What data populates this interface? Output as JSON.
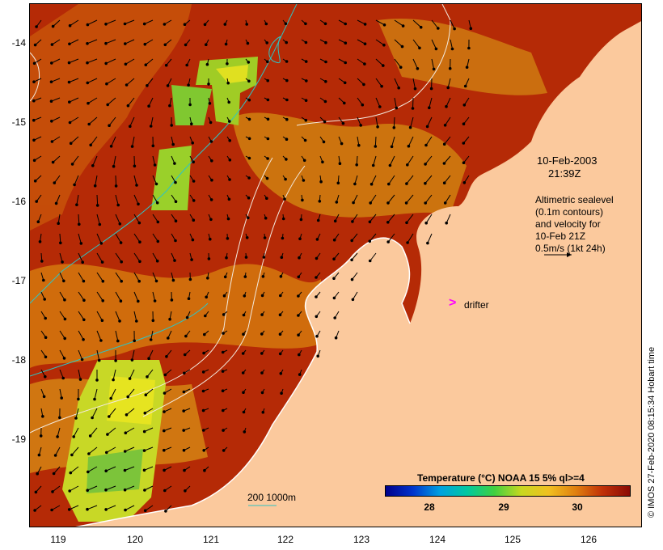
{
  "map": {
    "date_label": "10-Feb-2003",
    "time_label": "21:39Z",
    "altimetry_lines": [
      "Altimetric sealevel",
      "(0.1m contours)",
      "and velocity for",
      "10-Feb 21Z",
      "0.5m/s (1kt 24h)"
    ],
    "drifter_label": "drifter",
    "drifter_symbol": ">",
    "depth_label": "200 1000m",
    "credit": "© IMOS 27-Feb-2020 08:15:34 Hobart time",
    "lat_ticks": [
      "-14",
      "-15",
      "-16",
      "-17",
      "-18",
      "-19"
    ],
    "lon_ticks": [
      "119",
      "120",
      "121",
      "122",
      "123",
      "124",
      "125",
      "126"
    ],
    "colorbar": {
      "title": "Temperature (°C) NOAA 15 5% ql>=4",
      "ticks": [
        "28",
        "29",
        "30"
      ]
    },
    "colors": {
      "land": "#fbc99d",
      "ocean_warm": "#a81e04",
      "ocean_mid": "#c04208",
      "ocean_cool": "#d98a10",
      "green_patch": "#9ccd25",
      "yellow_patch": "#e0e020",
      "contour": "#f3eadf",
      "isobath": "#2ec4c4",
      "drifter": "#ff00ff"
    }
  }
}
